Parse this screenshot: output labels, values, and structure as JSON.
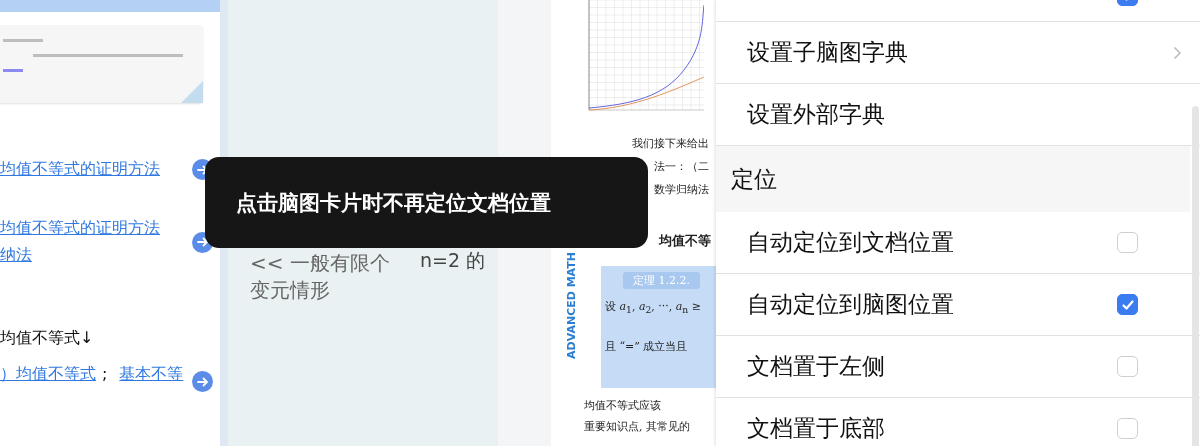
{
  "outline_panel": {
    "items": [
      {
        "kind": "link",
        "lines": [
          "均值不等式的证明方法"
        ]
      },
      {
        "kind": "link",
        "lines": [
          "均值不等式的证明方法",
          "纳法"
        ]
      },
      {
        "kind": "text",
        "lines": [
          "均值不等式↓"
        ]
      },
      {
        "kind": "link_pair",
        "links": [
          "）均值不等式",
          "基本不等"
        ],
        "separator": ";"
      }
    ]
  },
  "canvas": {
    "nodes": [
      {
        "lines": [
          "<< 一般有限个",
          "变元情形"
        ]
      },
      {
        "lines": [
          "n=2 的"
        ]
      }
    ]
  },
  "document": {
    "side_label": "ADVANCED MATH",
    "lines_top": [
      "我们接下来给出",
      "法一：（二",
      "数学归纳法"
    ],
    "heading": "均值不等",
    "theorem": {
      "title": "定理 1.2.2.",
      "lines": [
        "设 *a*$_{1}$, *a*$_{2}$, ···, *a*$_{n}$ ≥",
        "且 “=” 成立当且"
      ]
    },
    "lines_bottom": [
      "均值不等式应该",
      "重要知识点, 其常见的"
    ]
  },
  "settings_menu": {
    "items": [
      {
        "kind": "checkbox",
        "checked": true
      },
      {
        "kind": "submenu",
        "label": "设置子脑图字典"
      },
      {
        "kind": "action",
        "label": "设置外部字典"
      },
      {
        "kind": "section",
        "label": "定位"
      },
      {
        "kind": "checkbox",
        "label": "自动定位到文档位置",
        "checked": false
      },
      {
        "kind": "checkbox",
        "label": "自动定位到脑图位置",
        "checked": true
      },
      {
        "kind": "checkbox",
        "label": "文档置于左侧",
        "checked": false
      },
      {
        "kind": "checkbox",
        "label": "文档置于底部",
        "checked": false
      }
    ]
  },
  "toast": {
    "message": "点击脑图卡片时不再定位文档位置"
  }
}
